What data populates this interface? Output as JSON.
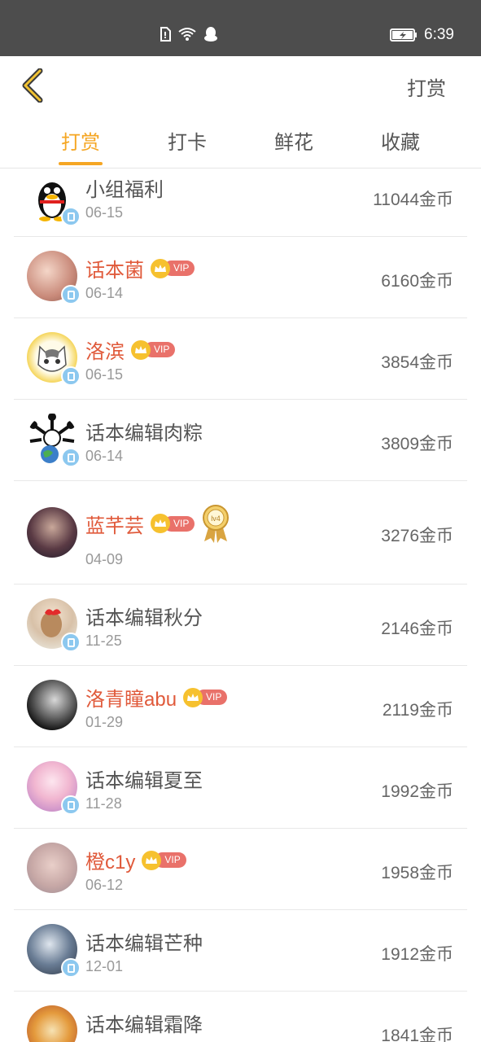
{
  "status_bar": {
    "time": "6:39",
    "icons": [
      "sim-icon",
      "wifi-icon",
      "qq-icon",
      "battery-icon"
    ]
  },
  "header": {
    "back_icon": "chevron-left-icon",
    "title_right": "打赏"
  },
  "tabs": [
    {
      "label": "打赏",
      "active": true
    },
    {
      "label": "打卡",
      "active": false
    },
    {
      "label": "鲜花",
      "active": false
    },
    {
      "label": "收藏",
      "active": false
    }
  ],
  "colors": {
    "accent": "#f5a623",
    "vip_name": "#e05a3b",
    "status_bar": "#4d4d4d",
    "official_badge": "#8cc8ef"
  },
  "vip_label": "VIP",
  "medal_label": "lv4",
  "rows": [
    {
      "name": "小组福利",
      "date": "06-15",
      "amount": "11044金币",
      "vip": false,
      "official": true
    },
    {
      "name": "话本菌",
      "date": "06-14",
      "amount": "6160金币",
      "vip": true,
      "official": true
    },
    {
      "name": "洛滨",
      "date": "06-15",
      "amount": "3854金币",
      "vip": true,
      "official": true
    },
    {
      "name": "话本编辑肉粽",
      "date": "06-14",
      "amount": "3809金币",
      "vip": false,
      "official": true
    },
    {
      "name": "蓝芊芸",
      "date": "04-09",
      "amount": "3276金币",
      "vip": true,
      "official": false,
      "medal": true
    },
    {
      "name": "话本编辑秋分",
      "date": "11-25",
      "amount": "2146金币",
      "vip": false,
      "official": true
    },
    {
      "name": "洛青瞳abu",
      "date": "01-29",
      "amount": "2119金币",
      "vip": true,
      "official": false
    },
    {
      "name": "话本编辑夏至",
      "date": "11-28",
      "amount": "1992金币",
      "vip": false,
      "official": true
    },
    {
      "name": "橙c1y",
      "date": "06-12",
      "amount": "1958金币",
      "vip": true,
      "official": false
    },
    {
      "name": "话本编辑芒种",
      "date": "12-01",
      "amount": "1912金币",
      "vip": false,
      "official": true
    },
    {
      "name": "话本编辑霜降",
      "date": "",
      "amount": "1841金币",
      "vip": false,
      "official": false
    }
  ]
}
